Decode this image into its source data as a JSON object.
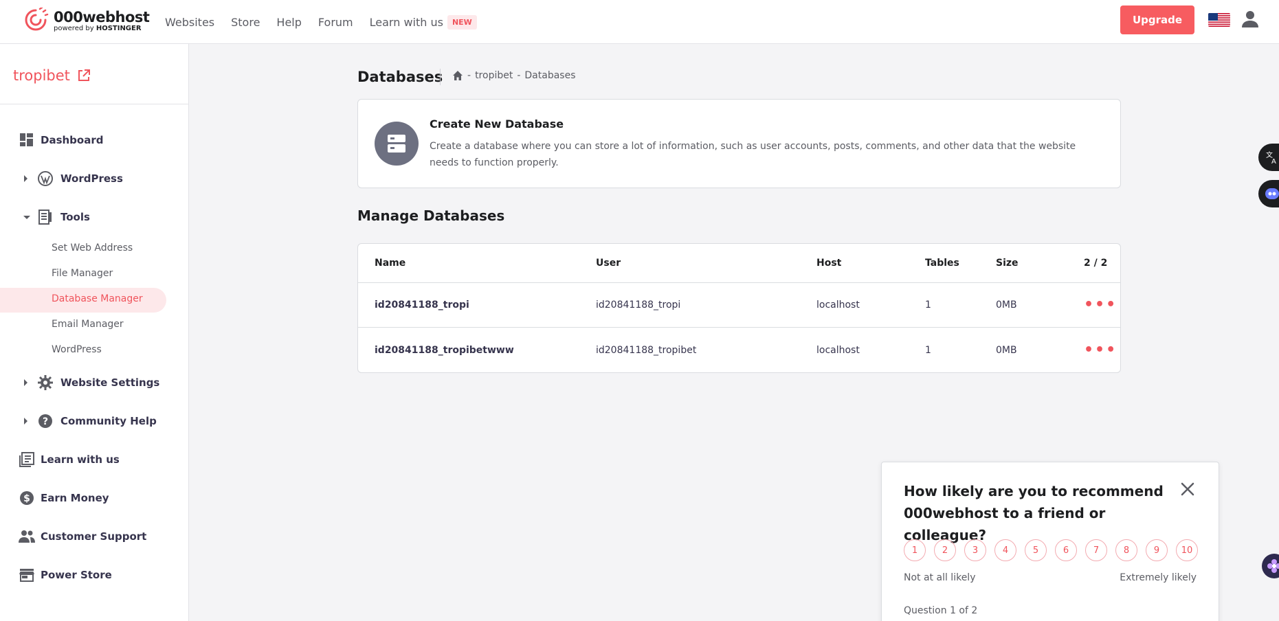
{
  "brand": {
    "name": "000webhost",
    "tagline_prefix": "powered by",
    "tagline_brand": "HOSTINGER"
  },
  "nav": {
    "items": [
      "Websites",
      "Store",
      "Help",
      "Forum",
      "Learn with us"
    ],
    "new_badge": "NEW",
    "upgrade": "Upgrade"
  },
  "sidebar": {
    "site_name": "tropibet",
    "items": {
      "dashboard": "Dashboard",
      "wordpress": "WordPress",
      "tools": "Tools",
      "website_settings": "Website Settings",
      "community_help": "Community Help",
      "learn": "Learn with us",
      "earn": "Earn Money",
      "support": "Customer Support",
      "power_store": "Power Store"
    },
    "tools_sub": [
      "Set Web Address",
      "File Manager",
      "Database Manager",
      "Email Manager",
      "WordPress"
    ],
    "active_sub": "Database Manager"
  },
  "page": {
    "title": "Databases",
    "breadcrumb_site": "tropibet",
    "breadcrumb_page": "Databases",
    "breadcrumb_sep": "-"
  },
  "create_card": {
    "title": "Create New Database",
    "description": "Create a database where you can store a lot of information, such as user accounts, posts, comments, and other data that the website needs to function properly."
  },
  "manage": {
    "title": "Manage Databases",
    "columns": {
      "name": "Name",
      "user": "User",
      "host": "Host",
      "tables": "Tables",
      "size": "Size",
      "count": "2 / 2"
    },
    "rows": [
      {
        "name": "id20841188_tropi",
        "user": "id20841188_tropi",
        "host": "localhost",
        "tables": "1",
        "size": "0MB"
      },
      {
        "name": "id20841188_tropibetwww",
        "user": "id20841188_tropibet",
        "host": "localhost",
        "tables": "1",
        "size": "0MB"
      }
    ],
    "actions": "•••"
  },
  "survey": {
    "question": "How likely are you to recommend 000webhost to a friend or colleague?",
    "ratings": [
      "1",
      "2",
      "3",
      "4",
      "5",
      "6",
      "7",
      "8",
      "9",
      "10"
    ],
    "low_label": "Not at all likely",
    "high_label": "Extremely likely",
    "progress": "Question 1 of 2"
  },
  "colors": {
    "accent": "#f75c60",
    "accent_text": "#f0545c",
    "accent_bg": "#fde8ea",
    "icon_gray": "#6d7081"
  },
  "icons": [
    "logo-icon",
    "us-flag-icon",
    "user-icon",
    "external-link-icon",
    "dashboard-icon",
    "wordpress-icon",
    "tools-icon",
    "gear-icon",
    "help-icon",
    "book-icon",
    "dollar-icon",
    "people-icon",
    "store-icon",
    "home-icon",
    "database-icon",
    "close-icon",
    "translate-icon",
    "bot-icon",
    "flower-icon"
  ]
}
